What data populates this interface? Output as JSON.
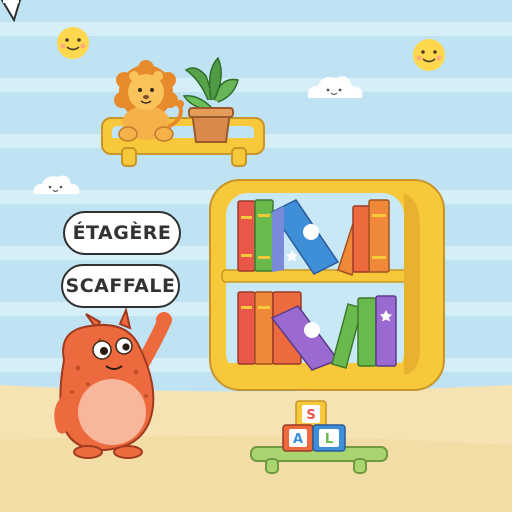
{
  "labels": {
    "french_word": "ÉTAGÈRE",
    "italian_word": "SCAFFALE"
  },
  "blocks": [
    "S",
    "A",
    "L"
  ],
  "colors": {
    "sky": "#bfe3f3",
    "sky_stripe": "#d5eef8",
    "floor": "#f6e3b4",
    "shelf_yellow": "#f7c83a",
    "monster": "#ec6a3e",
    "monster_belly": "#f8b79a",
    "small_shelf_green": "#a9d46f"
  },
  "icons": [
    "sun-icon",
    "cloud-icon",
    "lion-toy-icon",
    "plant-pot-icon",
    "book-icon",
    "letter-block-icon",
    "monster-icon"
  ]
}
